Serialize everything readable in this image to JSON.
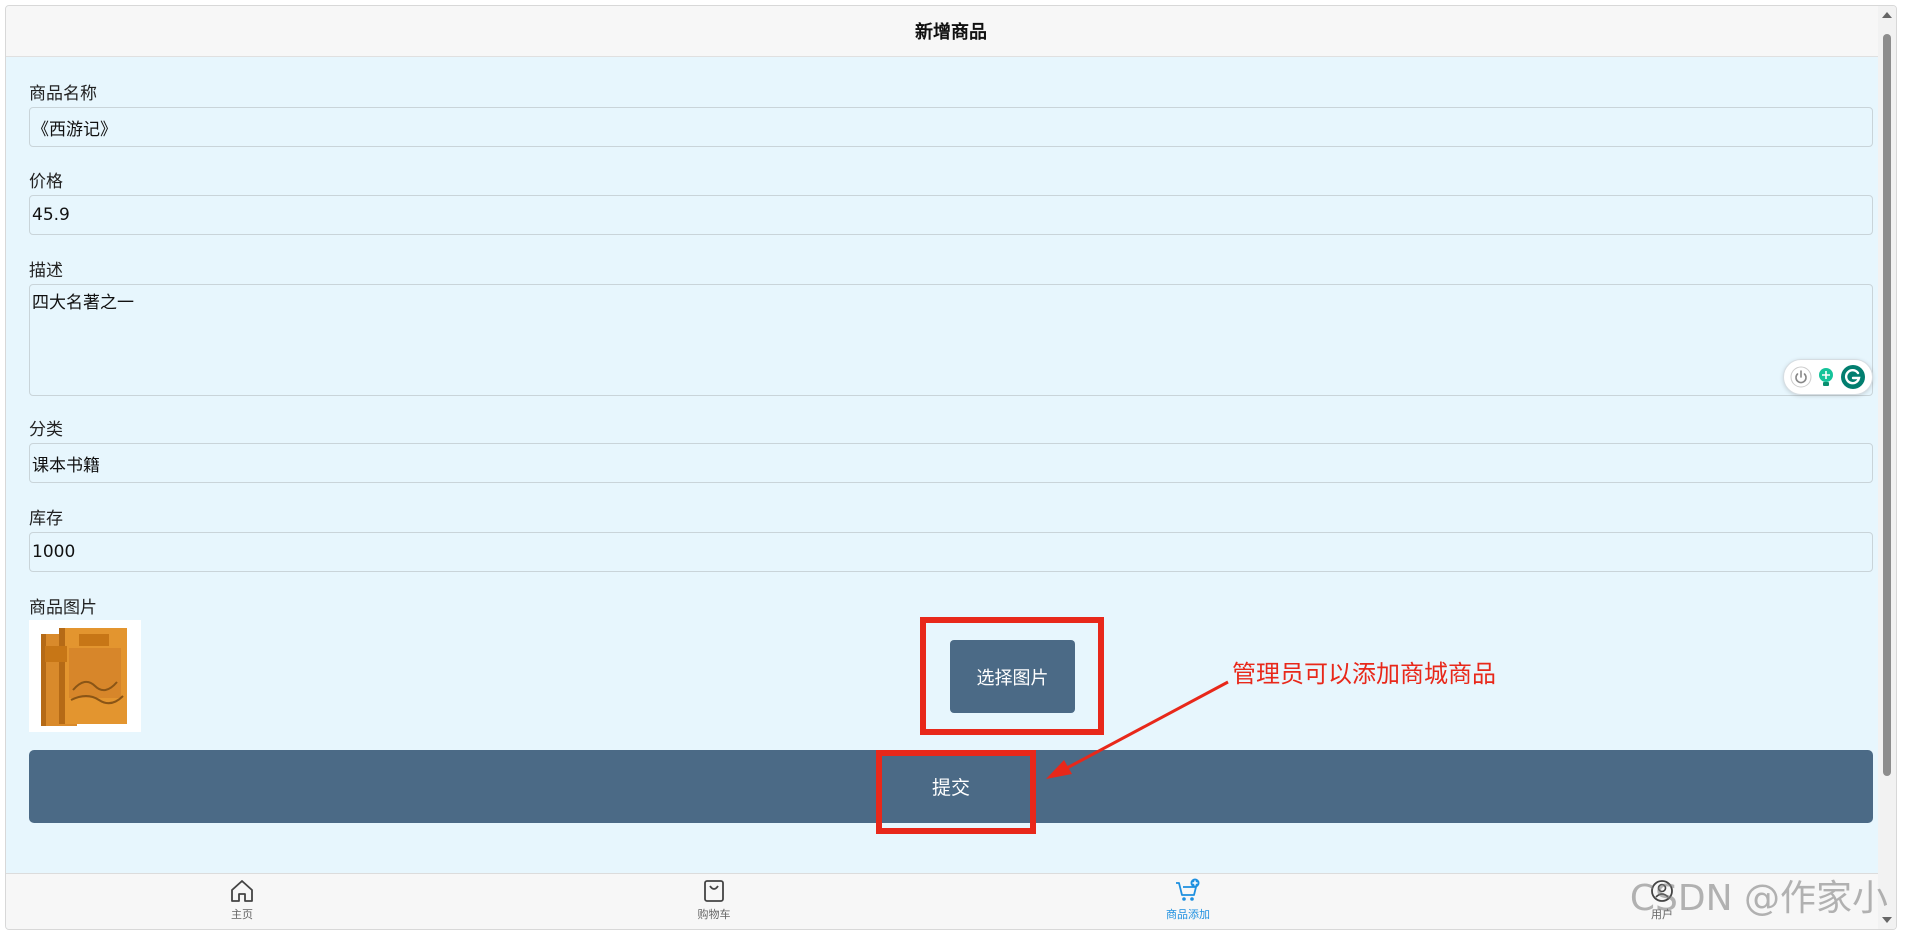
{
  "header": {
    "title": "新增商品"
  },
  "form": {
    "name": {
      "label": "商品名称",
      "value": "《西游记》"
    },
    "price": {
      "label": "价格",
      "value": "45.9"
    },
    "description": {
      "label": "描述",
      "value": "四大名著之一"
    },
    "category": {
      "label": "分类",
      "value": "课本书籍"
    },
    "stock": {
      "label": "库存",
      "value": "1000"
    },
    "image": {
      "label": "商品图片",
      "select_label": "选择图片"
    },
    "submit_label": "提交"
  },
  "annotation": {
    "text": "管理员可以添加商城商品",
    "color": "#e8281a"
  },
  "tabbar": {
    "items": [
      {
        "label": "主页",
        "icon": "home-icon"
      },
      {
        "label": "购物车",
        "icon": "shopping-bag-icon"
      },
      {
        "label": "商品添加",
        "icon": "cart-add-icon",
        "active": true
      },
      {
        "label": "用户",
        "icon": "user-icon"
      }
    ]
  },
  "watermark": "CSDN @作家小",
  "colors": {
    "accent": "#4b6a86",
    "active_tab": "#1e90e0",
    "background": "#e7f6fd"
  }
}
